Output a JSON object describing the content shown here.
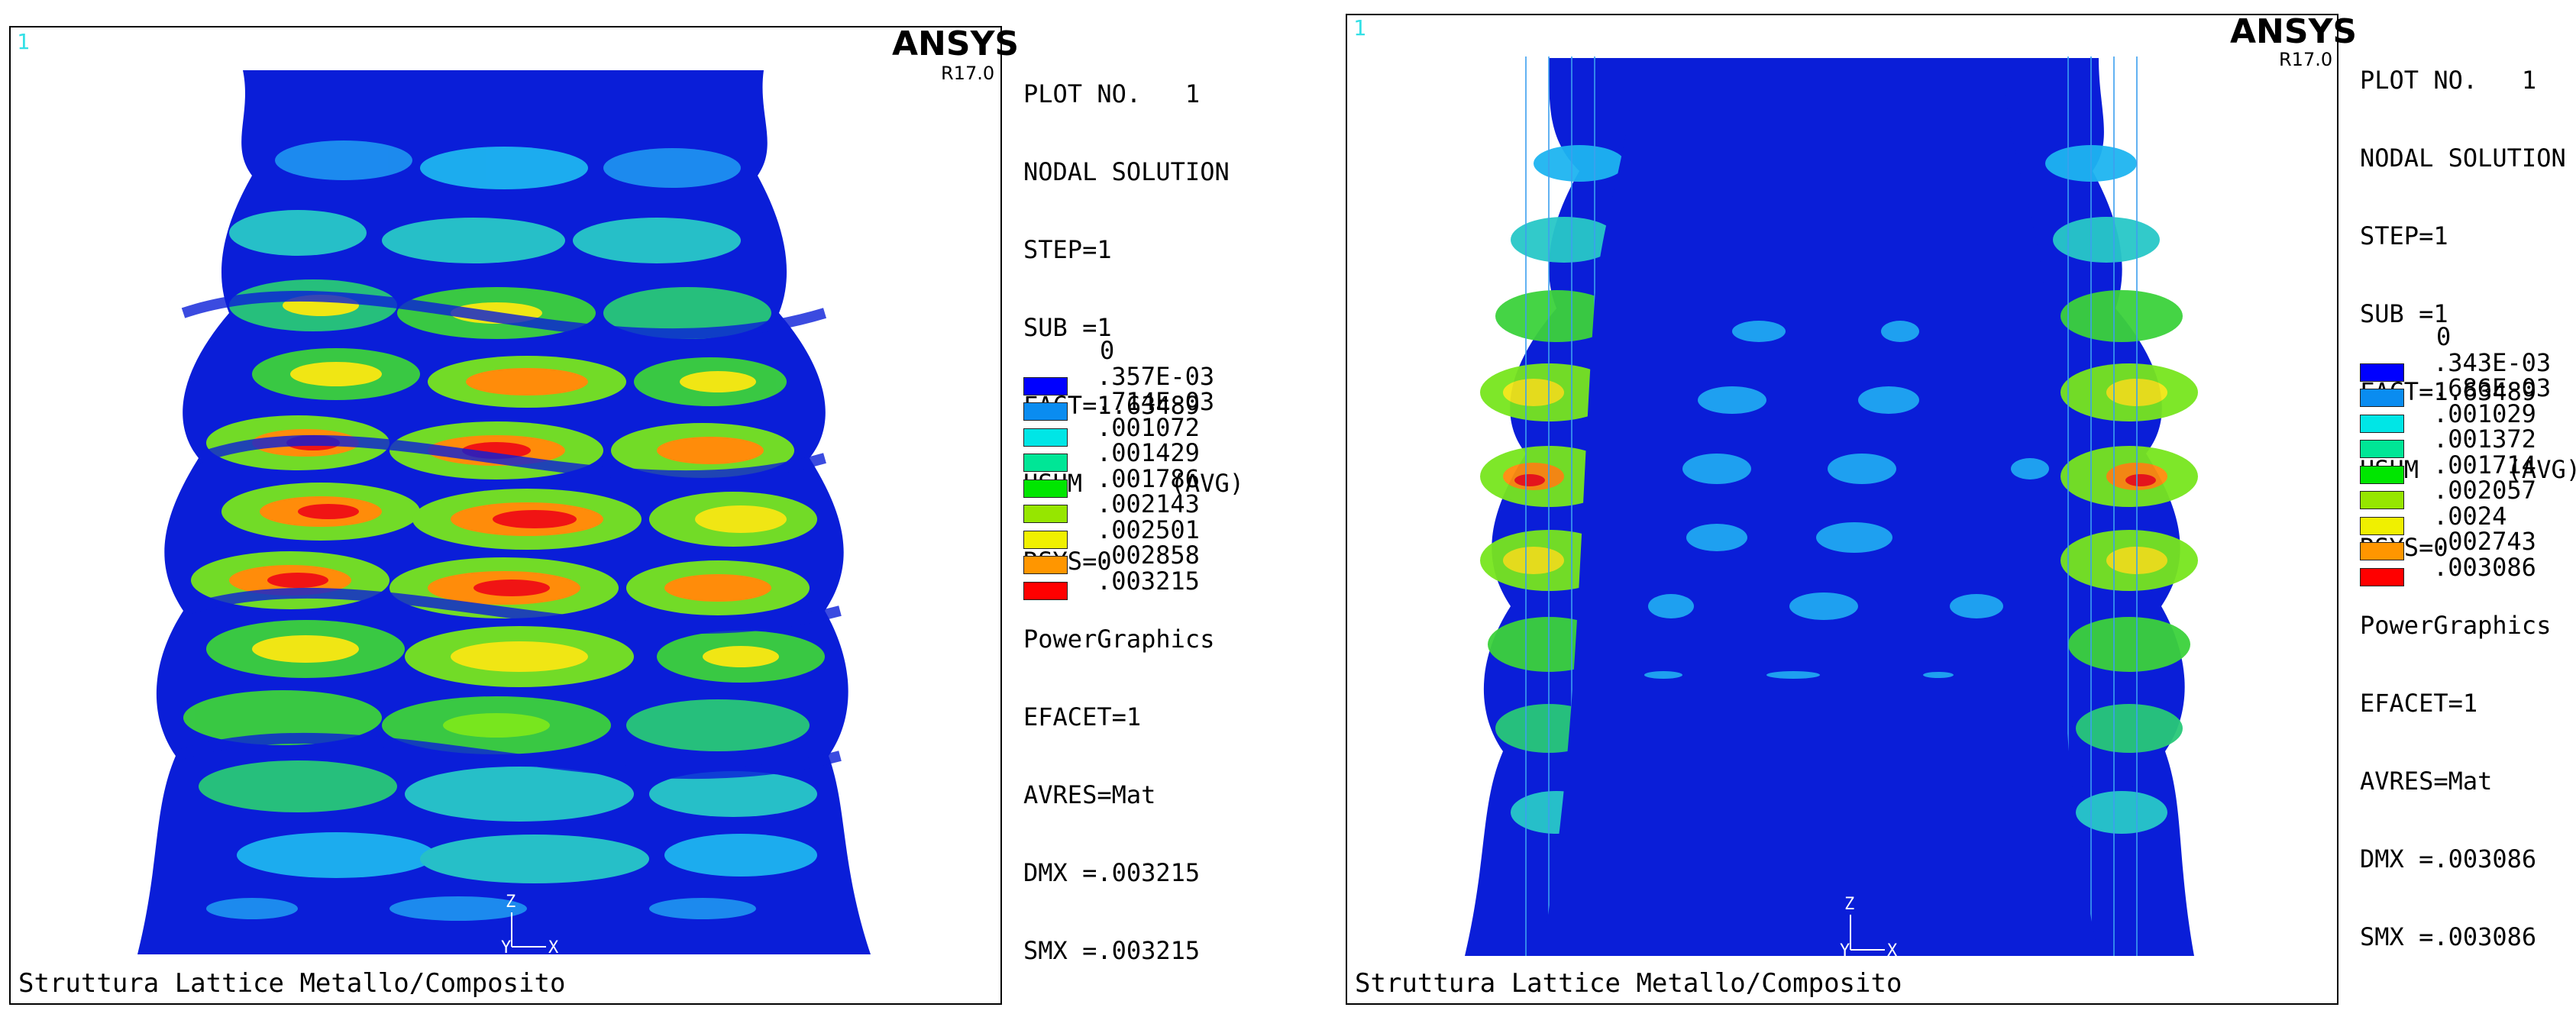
{
  "panels": [
    {
      "viewport": "1",
      "brand": "ANSYS",
      "version": "R17.0",
      "info": [
        "PLOT NO.   1",
        "NODAL SOLUTION",
        "STEP=1",
        "SUB =1",
        "FACT=1.63489",
        "USUM      (AVG)",
        "RSYS=0",
        "PowerGraphics",
        "EFACET=1",
        "AVRES=Mat",
        "DMX =.003215",
        "SMX =.003215"
      ],
      "legend_min": "0",
      "legend_values": [
        ".357E-03",
        ".714E-03",
        ".001072",
        ".001429",
        ".001786",
        ".002143",
        ".002501",
        ".002858",
        ".003215"
      ],
      "triad": {
        "z": "Z",
        "y": "Y",
        "x": "X"
      },
      "caption": "Struttura Lattice Metallo/Composito"
    },
    {
      "viewport": "1",
      "brand": "ANSYS",
      "version": "R17.0",
      "info": [
        "PLOT NO.   1",
        "NODAL SOLUTION",
        "STEP=1",
        "SUB =1",
        "FACT=1.63489",
        "USUM      (AVG)",
        "RSYS=0",
        "PowerGraphics",
        "EFACET=1",
        "AVRES=Mat",
        "DMX =.003086",
        "SMX =.003086"
      ],
      "legend_min": "0",
      "legend_values": [
        ".343E-03",
        ".686E-03",
        ".001029",
        ".001372",
        ".001714",
        ".002057",
        ".0024",
        ".002743",
        ".003086"
      ],
      "triad": {
        "z": "Z",
        "y": "Y",
        "x": "X"
      },
      "caption": "Struttura Lattice Metallo/Composito"
    }
  ],
  "legend_colors": [
    "#0000ff",
    "#0a8cf0",
    "#00e6e6",
    "#00e696",
    "#00e600",
    "#96e600",
    "#f0f000",
    "#ff9600",
    "#ff0000"
  ],
  "colors": {
    "background": "#0a1edc",
    "contour_band_1": "#1e64f0",
    "contour_band_2": "#1ea0f0",
    "contour_band_3": "#28d2dc",
    "contour_band_4": "#28d25a",
    "contour_band_5": "#78e61e",
    "contour_band_6": "#f0e614",
    "contour_band_7": "#ff8c0a",
    "contour_band_8": "#f01414"
  }
}
